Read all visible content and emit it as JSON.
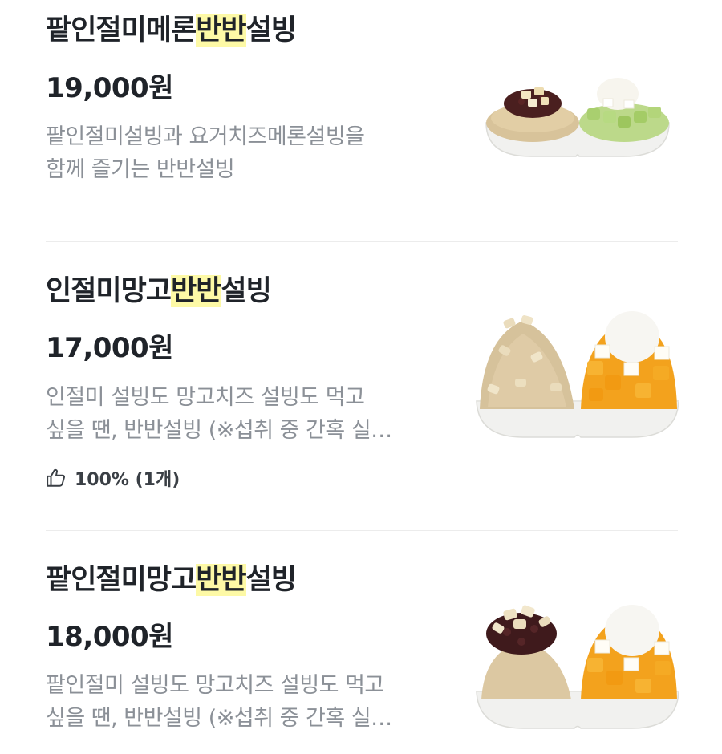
{
  "items": [
    {
      "title_pre": "팥인절미메론",
      "title_hl": "반반",
      "title_post": "설빙",
      "price": "19,000원",
      "desc_lines": [
        "팥인절미설빙과 요거치즈메론설빙을",
        "함께 즐기는 반반설빙"
      ],
      "thumb": "patinjeolmi-melon-banban-bingsu-photo"
    },
    {
      "title_pre": "인절미망고",
      "title_hl": "반반",
      "title_post": "설빙",
      "price": "17,000원",
      "desc_lines": [
        "인절미 설빙도 망고치즈 설빙도 먹고",
        "싶을 땐, 반반설빙 (※섭취 중 간혹 실…"
      ],
      "likes": "100% (1개)",
      "thumb": "injeolmi-mango-banban-bingsu-photo"
    },
    {
      "title_pre": "팥인절미망고",
      "title_hl": "반반",
      "title_post": "설빙",
      "price": "18,000원",
      "desc_lines": [
        "팥인절미 설빙도 망고치즈 설빙도 먹고",
        "싶을 땐, 반반설빙 (※섭취 중 간혹 실…"
      ],
      "thumb": "patinjeolmi-mango-banban-bingsu-photo"
    }
  ],
  "colors": {
    "highlight": "#fdf9a6",
    "text_primary": "#1f2329",
    "text_secondary": "#8b9097",
    "divider": "#ececec"
  },
  "icons": {
    "like": "thumbs-up-icon"
  }
}
